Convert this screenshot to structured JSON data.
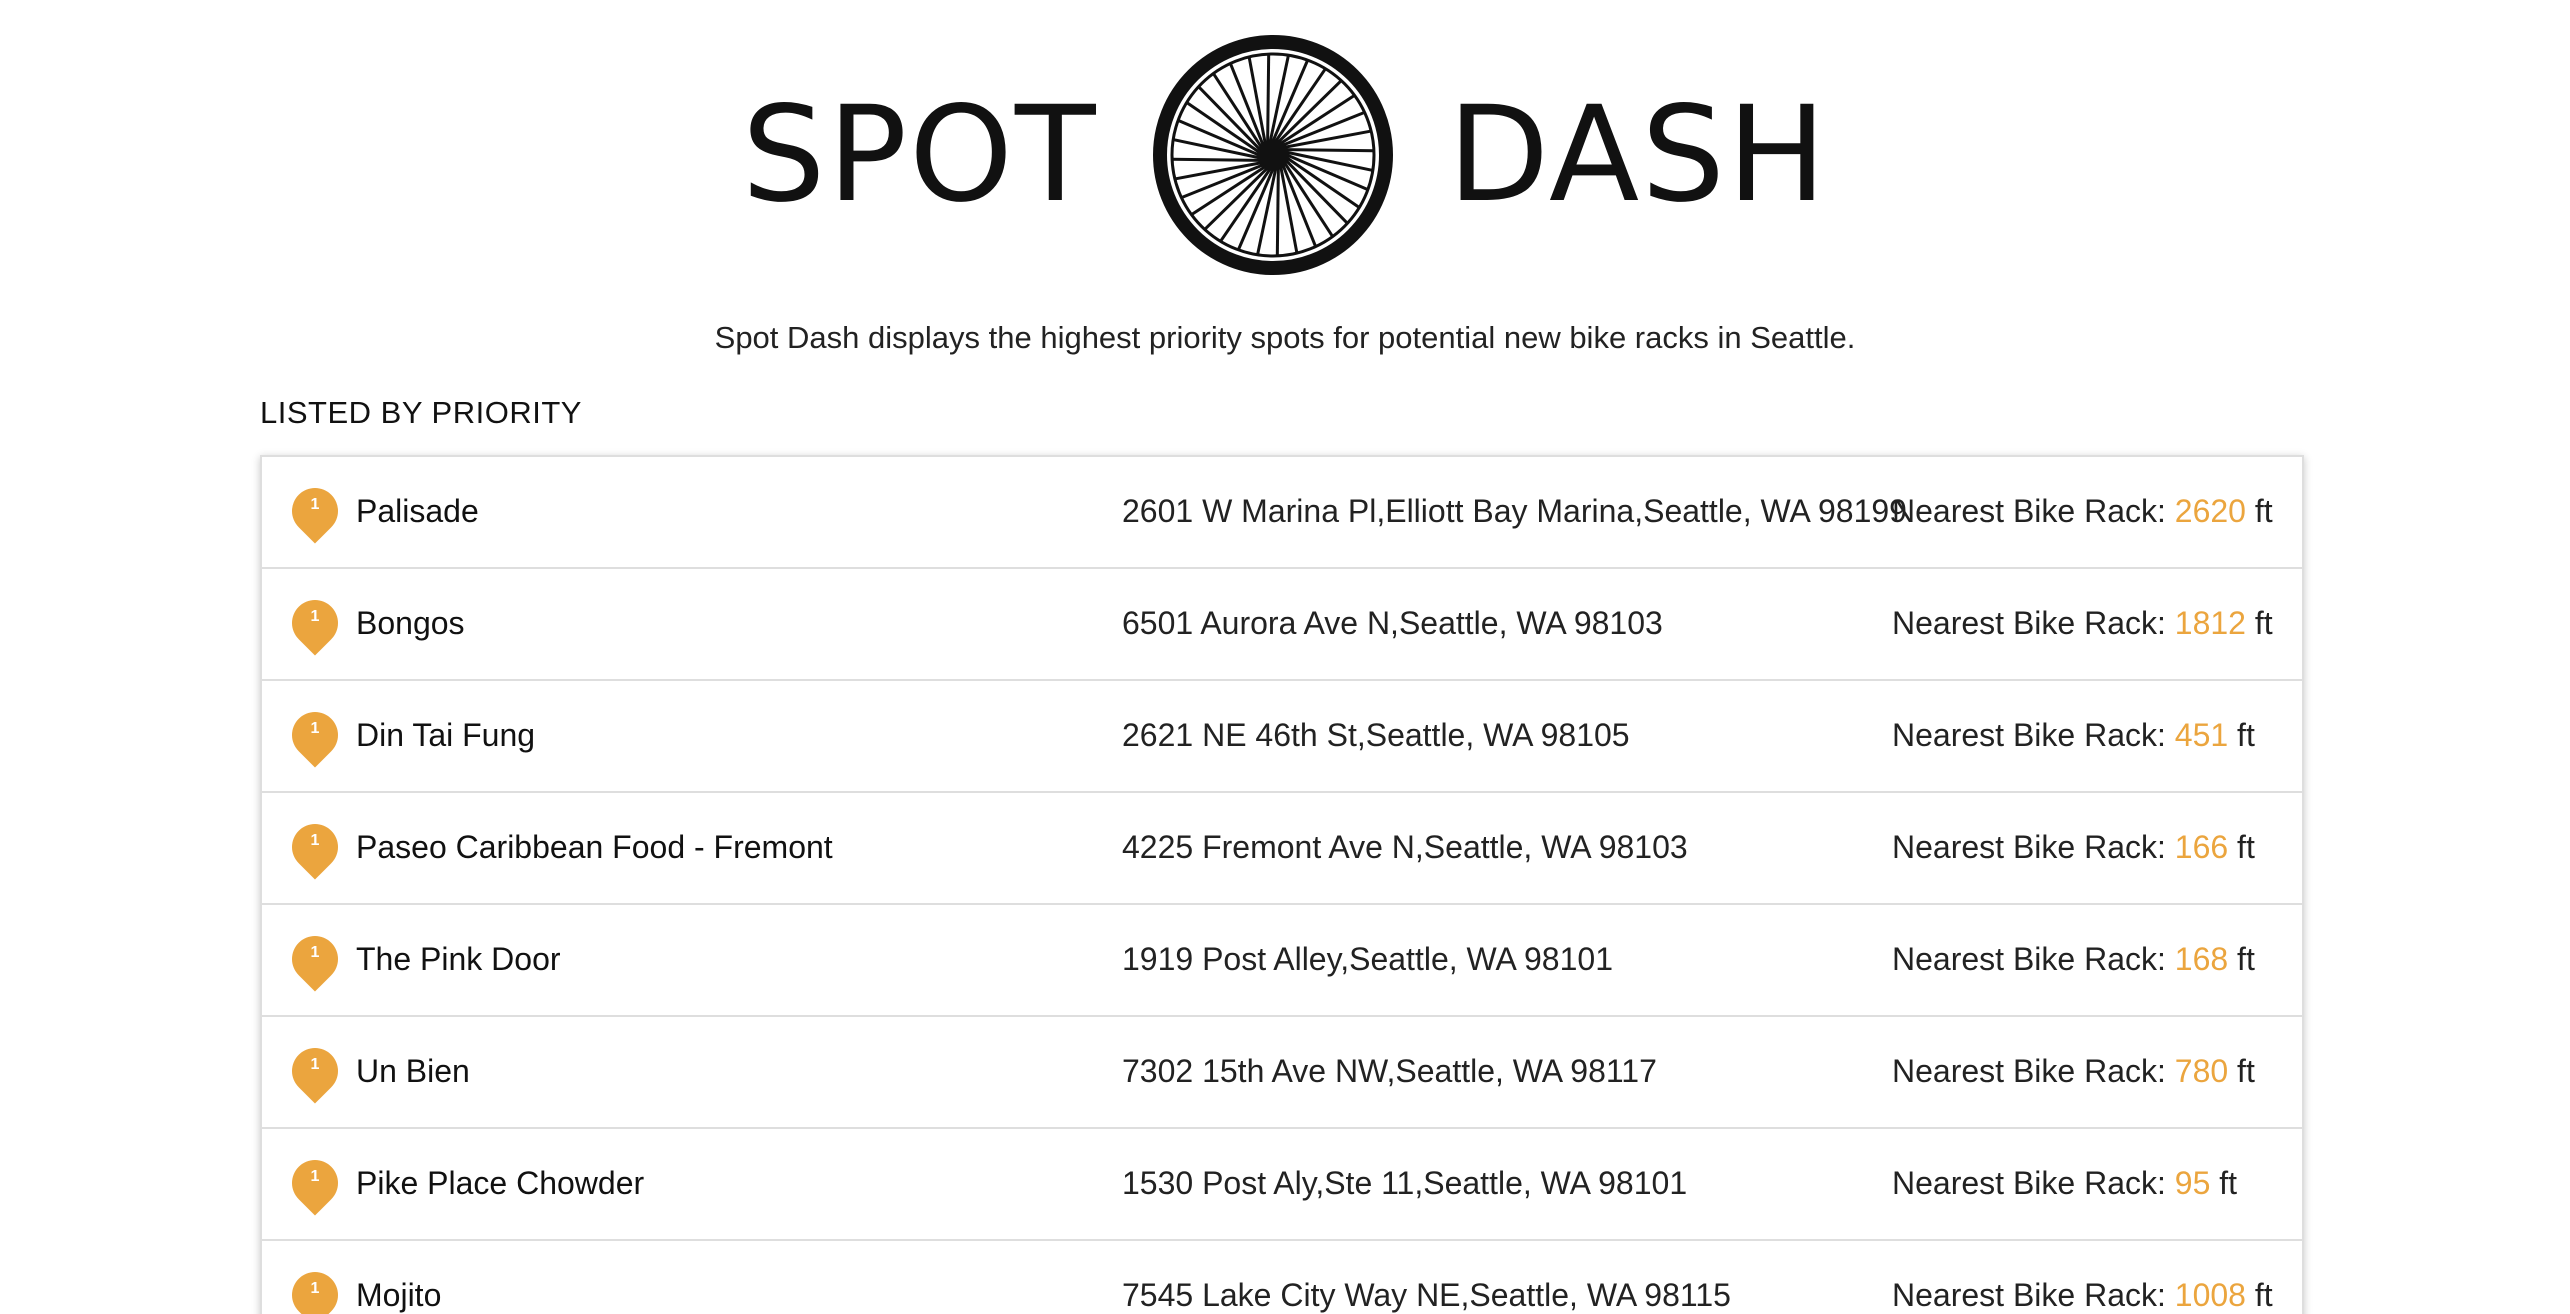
{
  "header": {
    "logo_left": "SPOT",
    "logo_right": "DASH",
    "logo_icon": "bicycle-wheel-icon"
  },
  "tagline": "Spot Dash displays the highest priority spots for potential new bike racks in Seattle.",
  "section_title": "LISTED BY PRIORITY",
  "colors": {
    "accent": "#eba53e",
    "text": "#222222",
    "border": "#dedede"
  },
  "rack_label": "Nearest Bike Rack:",
  "unit": "ft",
  "spots": [
    {
      "priority": "1",
      "name": "Palisade",
      "address": "2601 W Marina Pl,Elliott Bay Marina,Seattle, WA 98199",
      "distance": "2620"
    },
    {
      "priority": "1",
      "name": "Bongos",
      "address": "6501 Aurora Ave N,Seattle, WA 98103",
      "distance": "1812"
    },
    {
      "priority": "1",
      "name": "Din Tai Fung",
      "address": "2621 NE 46th St,Seattle, WA 98105",
      "distance": "451"
    },
    {
      "priority": "1",
      "name": "Paseo Caribbean Food - Fremont",
      "address": "4225 Fremont Ave N,Seattle, WA 98103",
      "distance": "166"
    },
    {
      "priority": "1",
      "name": "The Pink Door",
      "address": "1919 Post Alley,Seattle, WA 98101",
      "distance": "168"
    },
    {
      "priority": "1",
      "name": "Un Bien",
      "address": "7302 15th Ave NW,Seattle, WA 98117",
      "distance": "780"
    },
    {
      "priority": "1",
      "name": "Pike Place Chowder",
      "address": "1530 Post Aly,Ste 11,Seattle, WA 98101",
      "distance": "95"
    },
    {
      "priority": "1",
      "name": "Mojito",
      "address": "7545 Lake City Way NE,Seattle, WA 98115",
      "distance": "1008"
    }
  ]
}
